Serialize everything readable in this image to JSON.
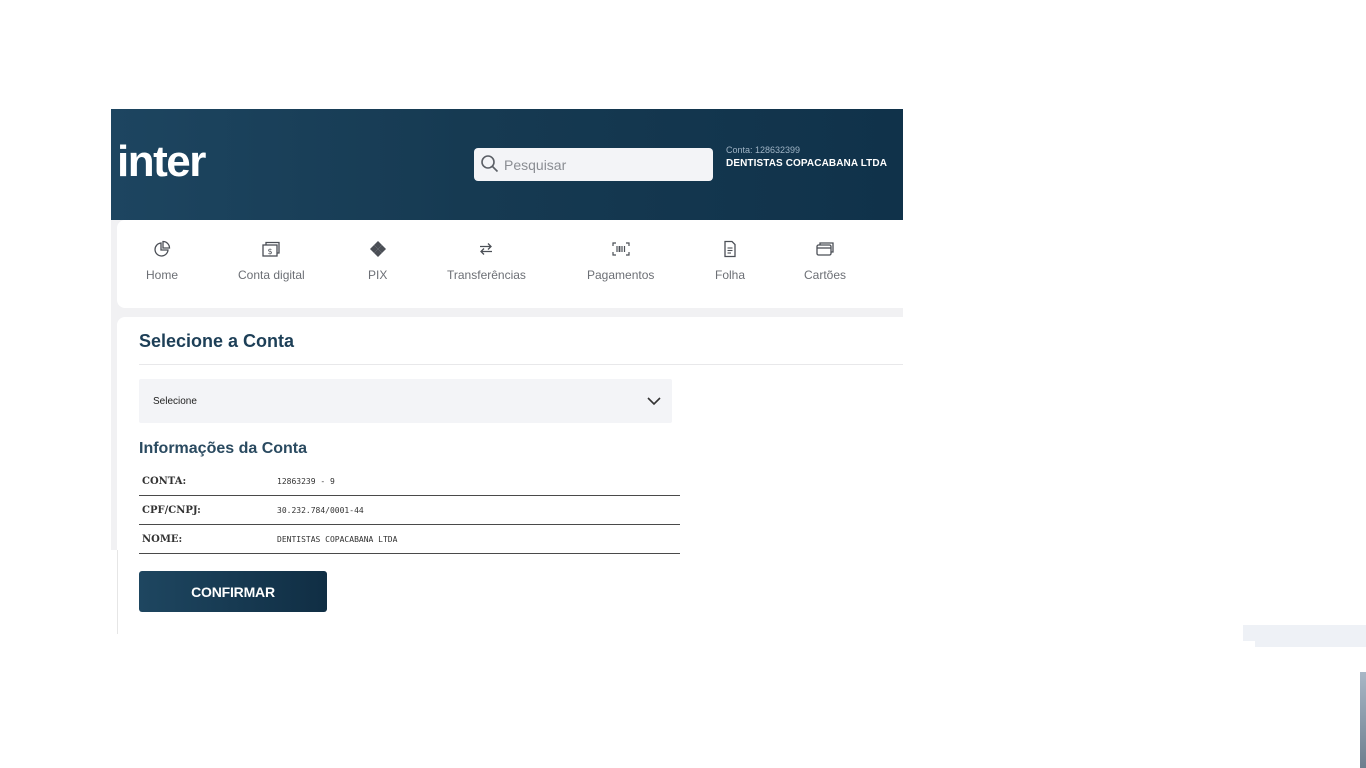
{
  "header": {
    "logo": "inter",
    "search": {
      "placeholder": "Pesquisar"
    },
    "account": {
      "number_label": "Conta: 128632399",
      "name": "DENTISTAS COPACABANA LTDA"
    }
  },
  "nav": {
    "items": [
      {
        "label": "Home",
        "icon": "pie-chart-icon"
      },
      {
        "label": "Conta digital",
        "icon": "money-note-icon"
      },
      {
        "label": "PIX",
        "icon": "pix-icon"
      },
      {
        "label": "Transferências",
        "icon": "transfer-arrows-icon"
      },
      {
        "label": "Pagamentos",
        "icon": "barcode-icon"
      },
      {
        "label": "Folha",
        "icon": "document-icon"
      },
      {
        "label": "Cartões",
        "icon": "cards-icon"
      }
    ]
  },
  "main": {
    "title": "Selecione a Conta",
    "select": {
      "value": "Selecione"
    },
    "info_title": "Informações da Conta",
    "info_rows": [
      {
        "key": "CONTA:",
        "value": "12863239 - 9"
      },
      {
        "key": "CPF/CNPJ:",
        "value": "30.232.784/0001-44"
      },
      {
        "key": "NOME:",
        "value": "DENTISTAS COPACABANA LTDA"
      }
    ],
    "confirm_label": "CONFIRMAR"
  },
  "colors": {
    "header": "#163a52",
    "accent": "#1d3f57",
    "button": "#153650"
  }
}
